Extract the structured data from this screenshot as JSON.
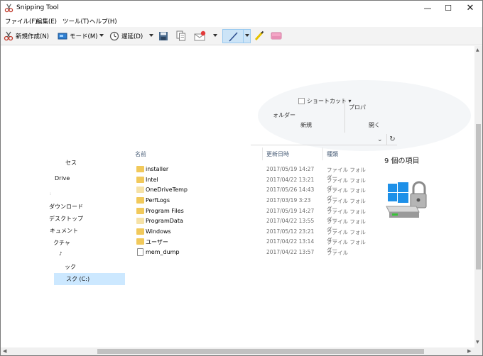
{
  "window": {
    "title": "Snipping Tool",
    "controls": {
      "minimize": "—",
      "maximize": "☐",
      "close": "✕"
    }
  },
  "menu": [
    "ファイル(F)",
    "編集(E)",
    "ツール(T)",
    "ヘルプ(H)"
  ],
  "toolbar": {
    "new_label": "新規作成(N)",
    "mode_label": "モード(M)",
    "delay_label": "遅延(D)"
  },
  "capture": {
    "ribbon": {
      "shortcut": "ショートカット ▾",
      "folder": "ォルダー",
      "properties": "プロパ",
      "group_new": "新規",
      "group_open": "開く"
    },
    "address_chevron": "⌄",
    "address_refresh": "↻",
    "nav": [
      {
        "label": "セス"
      },
      {
        "label": "Drive"
      },
      {
        "label": "ダウンロード"
      },
      {
        "label": "デスクトップ"
      },
      {
        "label": "キュメント"
      },
      {
        "label": "クチャ"
      },
      {
        "label": "ック"
      },
      {
        "label": "スク (C:)"
      }
    ],
    "columns": {
      "name": "名前",
      "date": "更新日時",
      "type": "種類"
    },
    "files": [
      {
        "name": "installer",
        "date": "2017/05/19 14:27",
        "type": "ファイル フォルダー",
        "icon": "folder-icon"
      },
      {
        "name": "Intel",
        "date": "2017/04/22 13:21",
        "type": "ファイル フォルダー",
        "icon": "folder-icon"
      },
      {
        "name": "OneDriveTemp",
        "date": "2017/05/26 14:43",
        "type": "ファイル フォルダー",
        "icon": "folder-icon"
      },
      {
        "name": "PerfLogs",
        "date": "2017/03/19 3:23",
        "type": "ファイル フォルダー",
        "icon": "folder-icon"
      },
      {
        "name": "Program Files",
        "date": "2017/05/19 14:27",
        "type": "ファイル フォルダー",
        "icon": "folder-icon"
      },
      {
        "name": "ProgramData",
        "date": "2017/04/22 13:55",
        "type": "ファイル フォルダー",
        "icon": "folder-icon"
      },
      {
        "name": "Windows",
        "date": "2017/05/12 23:21",
        "type": "ファイル フォルダー",
        "icon": "folder-icon"
      },
      {
        "name": "ユーザー",
        "date": "2017/04/22 13:14",
        "type": "ファイル フォルダー",
        "icon": "folder-icon"
      },
      {
        "name": "mem_dump",
        "date": "2017/04/22 13:57",
        "type": "ファイル",
        "icon": "file-icon"
      }
    ],
    "details": {
      "item_count": "9 個の項目"
    }
  },
  "colors": {
    "accent": "#cce4f7",
    "selection": "#cce8ff",
    "folder": "#f1c95b"
  }
}
